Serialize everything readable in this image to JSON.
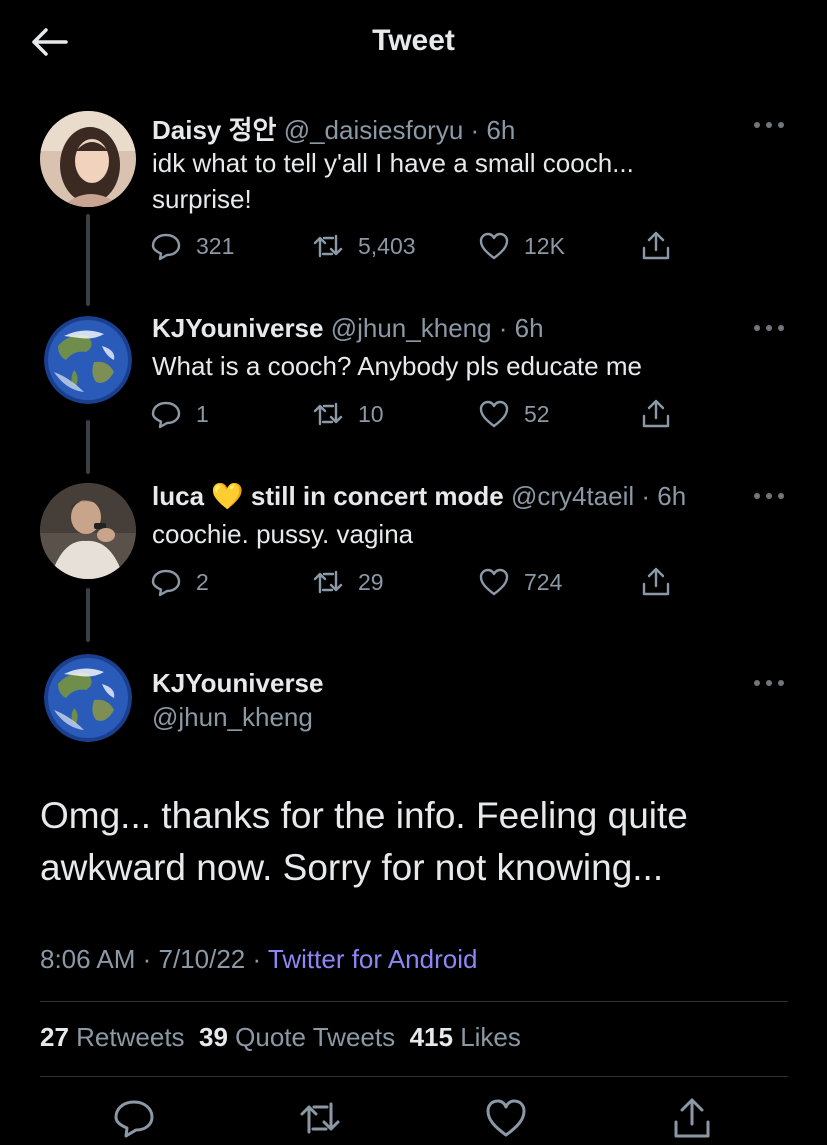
{
  "header": {
    "title": "Tweet"
  },
  "tweets": [
    {
      "name": "Daisy 정안",
      "handle": "@_daisiesforyu · 6h",
      "text_lines": [
        "idk what to tell y'all I have a small cooch...",
        "surprise!"
      ],
      "replies": "321",
      "retweets": "5,403",
      "likes": "12K"
    },
    {
      "name": "KJYouniverse",
      "handle": "@jhun_kheng · 6h",
      "text_lines": [
        "What is a cooch? Anybody pls educate me"
      ],
      "replies": "1",
      "retweets": "10",
      "likes": "52"
    },
    {
      "name": "luca",
      "name_emoji": "💛",
      "name_rest": "still in concert mode",
      "handle": "@cry4taeil · 6h",
      "text_lines": [
        "coochie. pussy. vagina"
      ],
      "replies": "2",
      "retweets": "29",
      "likes": "724"
    }
  ],
  "main_tweet": {
    "name": "KJYouniverse",
    "handle": "@jhun_kheng",
    "text": "Omg... thanks for the info. Feeling quite awkward now. Sorry for not knowing...",
    "time": "8:06 AM · 7/10/22 ·",
    "source": "Twitter for Android",
    "retweets_count": "27",
    "retweets_label": "Retweets",
    "quotes_count": "39",
    "quotes_label": "Quote Tweets",
    "likes_count": "415",
    "likes_label": "Likes"
  },
  "colors": {
    "background": "#000000",
    "text": "#e7e9ea",
    "muted": "#8b98a5",
    "link": "#8f86f5",
    "heart_emoji": "#f5c542"
  },
  "icons": [
    "back-arrow-icon",
    "reply-icon",
    "retweet-icon",
    "like-icon",
    "share-icon",
    "more-icon"
  ]
}
